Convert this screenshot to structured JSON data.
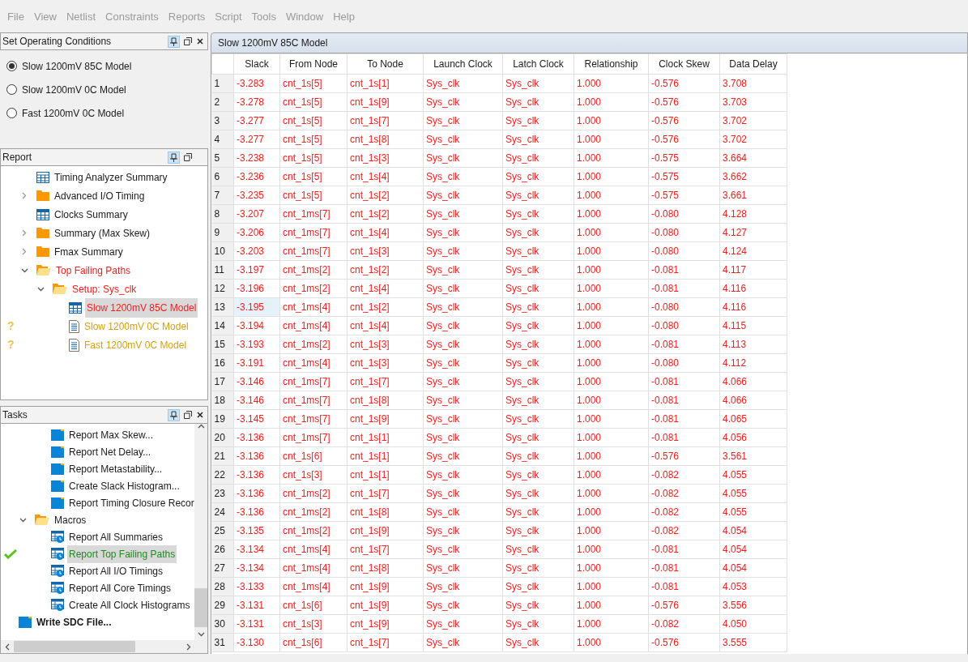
{
  "menu": [
    "File",
    "View",
    "Netlist",
    "Constraints",
    "Reports",
    "Script",
    "Tools",
    "Window",
    "Help"
  ],
  "operating_conditions": {
    "title": "Set Operating Conditions",
    "options": [
      {
        "label": "Slow 1200mV 85C Model",
        "selected": true
      },
      {
        "label": "Slow 1200mV 0C Model",
        "selected": false
      },
      {
        "label": "Fast 1200mV 0C Model",
        "selected": false
      }
    ]
  },
  "report": {
    "title": "Report",
    "items": [
      {
        "label": "Timing Analyzer Summary",
        "kind": "grid",
        "failing": false,
        "selected": false
      },
      {
        "label": "Advanced I/O Timing",
        "kind": "folder",
        "expanded": false,
        "failing": false,
        "selected": false
      },
      {
        "label": "Clocks Summary",
        "kind": "table",
        "failing": false,
        "selected": false
      },
      {
        "label": "Summary (Max Skew)",
        "kind": "folder",
        "expanded": false,
        "failing": false,
        "selected": false
      },
      {
        "label": "Fmax Summary",
        "kind": "folder",
        "expanded": false,
        "failing": false,
        "selected": false
      },
      {
        "label": "Top Failing Paths",
        "kind": "folder",
        "expanded": true,
        "failing": true,
        "selected": false,
        "children": [
          {
            "label": "Setup: Sys_clk",
            "kind": "folder",
            "expanded": true,
            "failing": true,
            "selected": false,
            "children": [
              {
                "label": "Slow 1200mV 85C Model",
                "kind": "table",
                "failing": true,
                "selected": true
              },
              {
                "label": "Slow 1200mV 0C Model",
                "kind": "doc",
                "failing": false,
                "marker": "?",
                "selected": false
              },
              {
                "label": "Fast 1200mV 0C Model",
                "kind": "doc",
                "failing": false,
                "marker": "?",
                "selected": false
              }
            ]
          }
        ]
      }
    ]
  },
  "tasks": {
    "title": "Tasks",
    "items": [
      {
        "label": "Report Max Skew...",
        "kind": "task",
        "done": false,
        "selected": false
      },
      {
        "label": "Report Net Delay...",
        "kind": "task",
        "done": false,
        "selected": false
      },
      {
        "label": "Report Metastability...",
        "kind": "task",
        "done": false,
        "selected": false
      },
      {
        "label": "Create Slack Histogram...",
        "kind": "task",
        "done": false,
        "selected": false
      },
      {
        "label": "Report Timing Closure Recor",
        "kind": "task",
        "done": false,
        "selected": false
      },
      {
        "label": "Macros",
        "kind": "folder",
        "expanded": true,
        "selected": false,
        "children": [
          {
            "label": "Report All Summaries",
            "kind": "macro",
            "done": false,
            "selected": false
          },
          {
            "label": "Report Top Failing Paths",
            "kind": "macro",
            "done": true,
            "selected": true
          },
          {
            "label": "Report All I/O Timings",
            "kind": "macro",
            "done": false,
            "selected": false
          },
          {
            "label": "Report All Core Timings",
            "kind": "macro",
            "done": false,
            "selected": false
          },
          {
            "label": "Create All Clock Histograms",
            "kind": "macro",
            "done": false,
            "selected": false
          }
        ]
      },
      {
        "label": "Write SDC File...",
        "kind": "top_task",
        "done": false,
        "selected": false
      }
    ]
  },
  "table": {
    "title": "Slow 1200mV 85C Model",
    "columns": [
      "Slack",
      "From Node",
      "To Node",
      "Launch Clock",
      "Latch Clock",
      "Relationship",
      "Clock Skew",
      "Data Delay"
    ],
    "rows": [
      {
        "index": "1",
        "selected": false,
        "cells": [
          "-3.283",
          "cnt_1s[5]",
          "cnt_1s[1]",
          "Sys_clk",
          "Sys_clk",
          "1.000",
          "-0.576",
          "3.708"
        ]
      },
      {
        "index": "2",
        "selected": false,
        "cells": [
          "-3.278",
          "cnt_1s[5]",
          "cnt_1s[9]",
          "Sys_clk",
          "Sys_clk",
          "1.000",
          "-0.576",
          "3.703"
        ]
      },
      {
        "index": "3",
        "selected": false,
        "cells": [
          "-3.277",
          "cnt_1s[5]",
          "cnt_1s[7]",
          "Sys_clk",
          "Sys_clk",
          "1.000",
          "-0.576",
          "3.702"
        ]
      },
      {
        "index": "4",
        "selected": false,
        "cells": [
          "-3.277",
          "cnt_1s[5]",
          "cnt_1s[8]",
          "Sys_clk",
          "Sys_clk",
          "1.000",
          "-0.576",
          "3.702"
        ]
      },
      {
        "index": "5",
        "selected": false,
        "cells": [
          "-3.238",
          "cnt_1s[5]",
          "cnt_1s[3]",
          "Sys_clk",
          "Sys_clk",
          "1.000",
          "-0.575",
          "3.664"
        ]
      },
      {
        "index": "6",
        "selected": false,
        "cells": [
          "-3.236",
          "cnt_1s[5]",
          "cnt_1s[4]",
          "Sys_clk",
          "Sys_clk",
          "1.000",
          "-0.575",
          "3.662"
        ]
      },
      {
        "index": "7",
        "selected": false,
        "cells": [
          "-3.235",
          "cnt_1s[5]",
          "cnt_1s[2]",
          "Sys_clk",
          "Sys_clk",
          "1.000",
          "-0.575",
          "3.661"
        ]
      },
      {
        "index": "8",
        "selected": false,
        "cells": [
          "-3.207",
          "cnt_1ms[7]",
          "cnt_1s[2]",
          "Sys_clk",
          "Sys_clk",
          "1.000",
          "-0.080",
          "4.128"
        ]
      },
      {
        "index": "9",
        "selected": false,
        "cells": [
          "-3.206",
          "cnt_1ms[7]",
          "cnt_1s[4]",
          "Sys_clk",
          "Sys_clk",
          "1.000",
          "-0.080",
          "4.127"
        ]
      },
      {
        "index": "10",
        "selected": false,
        "cells": [
          "-3.203",
          "cnt_1ms[7]",
          "cnt_1s[3]",
          "Sys_clk",
          "Sys_clk",
          "1.000",
          "-0.080",
          "4.124"
        ]
      },
      {
        "index": "11",
        "selected": false,
        "cells": [
          "-3.197",
          "cnt_1ms[2]",
          "cnt_1s[2]",
          "Sys_clk",
          "Sys_clk",
          "1.000",
          "-0.081",
          "4.117"
        ]
      },
      {
        "index": "12",
        "selected": false,
        "cells": [
          "-3.196",
          "cnt_1ms[2]",
          "cnt_1s[4]",
          "Sys_clk",
          "Sys_clk",
          "1.000",
          "-0.081",
          "4.116"
        ]
      },
      {
        "index": "13",
        "selected": true,
        "cells": [
          "-3.195",
          "cnt_1ms[4]",
          "cnt_1s[2]",
          "Sys_clk",
          "Sys_clk",
          "1.000",
          "-0.080",
          "4.116"
        ]
      },
      {
        "index": "14",
        "selected": false,
        "cells": [
          "-3.194",
          "cnt_1ms[4]",
          "cnt_1s[4]",
          "Sys_clk",
          "Sys_clk",
          "1.000",
          "-0.080",
          "4.115"
        ]
      },
      {
        "index": "15",
        "selected": false,
        "cells": [
          "-3.193",
          "cnt_1ms[2]",
          "cnt_1s[3]",
          "Sys_clk",
          "Sys_clk",
          "1.000",
          "-0.081",
          "4.113"
        ]
      },
      {
        "index": "16",
        "selected": false,
        "cells": [
          "-3.191",
          "cnt_1ms[4]",
          "cnt_1s[3]",
          "Sys_clk",
          "Sys_clk",
          "1.000",
          "-0.080",
          "4.112"
        ]
      },
      {
        "index": "17",
        "selected": false,
        "cells": [
          "-3.146",
          "cnt_1ms[7]",
          "cnt_1s[7]",
          "Sys_clk",
          "Sys_clk",
          "1.000",
          "-0.081",
          "4.066"
        ]
      },
      {
        "index": "18",
        "selected": false,
        "cells": [
          "-3.146",
          "cnt_1ms[7]",
          "cnt_1s[8]",
          "Sys_clk",
          "Sys_clk",
          "1.000",
          "-0.081",
          "4.066"
        ]
      },
      {
        "index": "19",
        "selected": false,
        "cells": [
          "-3.145",
          "cnt_1ms[7]",
          "cnt_1s[9]",
          "Sys_clk",
          "Sys_clk",
          "1.000",
          "-0.081",
          "4.065"
        ]
      },
      {
        "index": "20",
        "selected": false,
        "cells": [
          "-3.136",
          "cnt_1ms[7]",
          "cnt_1s[1]",
          "Sys_clk",
          "Sys_clk",
          "1.000",
          "-0.081",
          "4.056"
        ]
      },
      {
        "index": "21",
        "selected": false,
        "cells": [
          "-3.136",
          "cnt_1s[6]",
          "cnt_1s[1]",
          "Sys_clk",
          "Sys_clk",
          "1.000",
          "-0.576",
          "3.561"
        ]
      },
      {
        "index": "22",
        "selected": false,
        "cells": [
          "-3.136",
          "cnt_1s[3]",
          "cnt_1s[1]",
          "Sys_clk",
          "Sys_clk",
          "1.000",
          "-0.082",
          "4.055"
        ]
      },
      {
        "index": "23",
        "selected": false,
        "cells": [
          "-3.136",
          "cnt_1ms[2]",
          "cnt_1s[7]",
          "Sys_clk",
          "Sys_clk",
          "1.000",
          "-0.082",
          "4.055"
        ]
      },
      {
        "index": "24",
        "selected": false,
        "cells": [
          "-3.136",
          "cnt_1ms[2]",
          "cnt_1s[8]",
          "Sys_clk",
          "Sys_clk",
          "1.000",
          "-0.082",
          "4.055"
        ]
      },
      {
        "index": "25",
        "selected": false,
        "cells": [
          "-3.135",
          "cnt_1ms[2]",
          "cnt_1s[9]",
          "Sys_clk",
          "Sys_clk",
          "1.000",
          "-0.082",
          "4.054"
        ]
      },
      {
        "index": "26",
        "selected": false,
        "cells": [
          "-3.134",
          "cnt_1ms[4]",
          "cnt_1s[7]",
          "Sys_clk",
          "Sys_clk",
          "1.000",
          "-0.081",
          "4.054"
        ]
      },
      {
        "index": "27",
        "selected": false,
        "cells": [
          "-3.134",
          "cnt_1ms[4]",
          "cnt_1s[8]",
          "Sys_clk",
          "Sys_clk",
          "1.000",
          "-0.081",
          "4.054"
        ]
      },
      {
        "index": "28",
        "selected": false,
        "cells": [
          "-3.133",
          "cnt_1ms[4]",
          "cnt_1s[9]",
          "Sys_clk",
          "Sys_clk",
          "1.000",
          "-0.081",
          "4.053"
        ]
      },
      {
        "index": "29",
        "selected": false,
        "cells": [
          "-3.131",
          "cnt_1s[6]",
          "cnt_1s[9]",
          "Sys_clk",
          "Sys_clk",
          "1.000",
          "-0.576",
          "3.556"
        ]
      },
      {
        "index": "30",
        "selected": false,
        "cells": [
          "-3.131",
          "cnt_1s[3]",
          "cnt_1s[9]",
          "Sys_clk",
          "Sys_clk",
          "1.000",
          "-0.082",
          "4.050"
        ]
      },
      {
        "index": "31",
        "selected": false,
        "cells": [
          "-3.130",
          "cnt_1s[6]",
          "cnt_1s[7]",
          "Sys_clk",
          "Sys_clk",
          "1.000",
          "-0.576",
          "3.555"
        ]
      }
    ]
  }
}
